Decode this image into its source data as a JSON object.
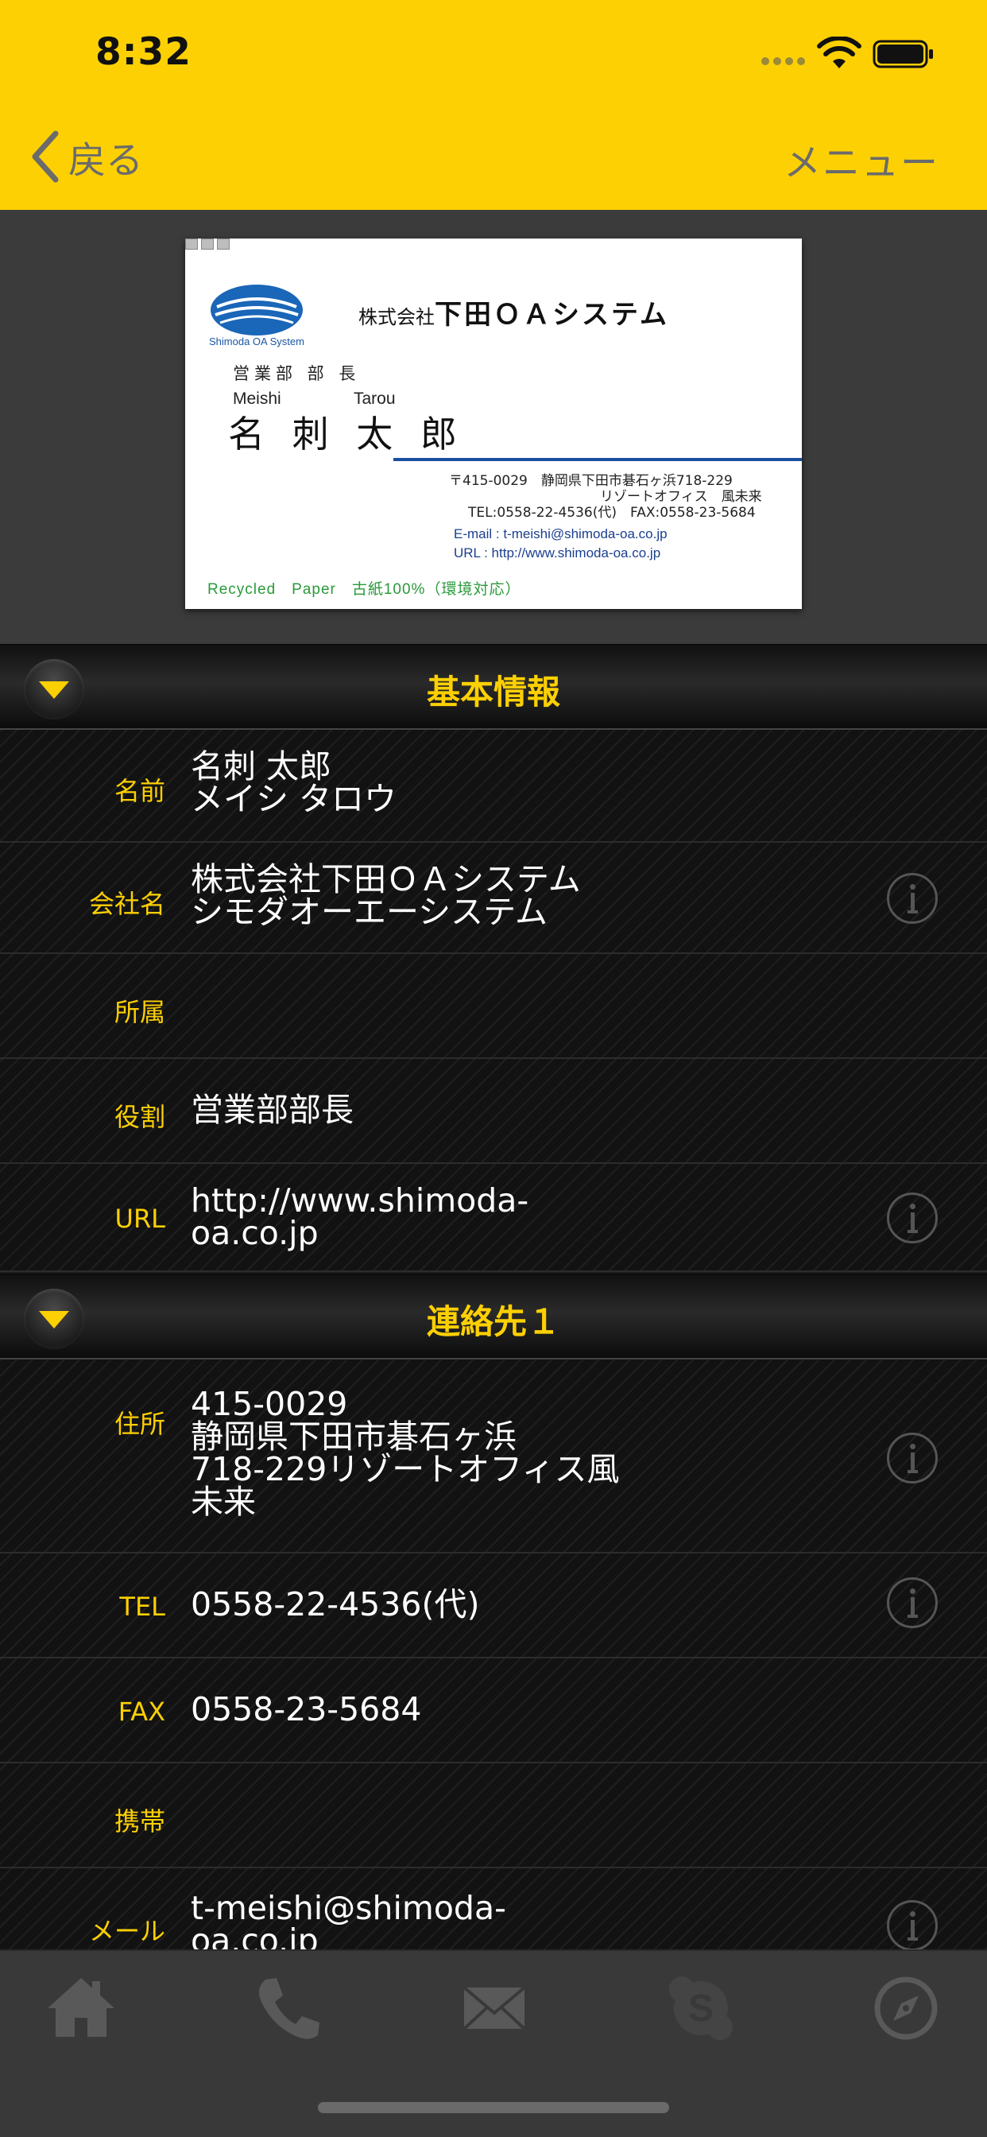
{
  "status_bar": {
    "time": "8:32"
  },
  "nav": {
    "back_label": "戻る",
    "menu_label": "メニュー"
  },
  "card_image": {
    "company_prefix": "株式会社",
    "company_name": "下田ＯＡシステム",
    "logo_text": "Shimoda OA System",
    "department": "営業部 部 長",
    "roman_family": "Meishi",
    "roman_given": "Tarou",
    "name": "名 刺  太 郎",
    "address_line1": "〒415-0029　静岡県下田市碁石ヶ浜718-229",
    "address_line2": "リゾートオフィス　風未来",
    "address_line3": "TEL:0558-22-4536(代)　FAX:0558-23-5684",
    "email": "E-mail : t-meishi@shimoda-oa.co.jp",
    "url": "URL : http://www.shimoda-oa.co.jp",
    "recycled": "Recycled　Paper　古紙100%（環境対応）"
  },
  "sections": [
    {
      "title": "基本情報",
      "rows": [
        {
          "label": "名前",
          "lines": [
            "名刺 太郎",
            "メイシ タロウ"
          ]
        },
        {
          "label": "会社名",
          "lines": [
            "株式会社下田ＯＡシステム",
            "シモダオーエーシステム"
          ]
        },
        {
          "label": "所属",
          "lines": []
        },
        {
          "label": "役割",
          "lines": [
            "営業部部長"
          ]
        },
        {
          "label": "URL",
          "lines": [
            "http://www.shimoda-",
            "oa.co.jp"
          ]
        }
      ]
    },
    {
      "title": "連絡先１",
      "rows": [
        {
          "label": "住所",
          "lines": [
            "415-0029",
            "静岡県下田市碁石ヶ浜",
            "718-229リゾートオフィス風",
            "未来"
          ]
        },
        {
          "label": "TEL",
          "lines": [
            "0558-22-4536(代)"
          ]
        },
        {
          "label": "FAX",
          "lines": [
            "0558-23-5684"
          ]
        },
        {
          "label": "携帯",
          "lines": []
        },
        {
          "label": "メール",
          "lines": [
            "t-meishi@shimoda-",
            "oa.co.jp"
          ]
        }
      ]
    }
  ],
  "tabbar": {
    "icons": [
      "home-icon",
      "phone-icon",
      "mail-icon",
      "skype-icon",
      "compass-icon"
    ]
  },
  "colors": {
    "accent": "#fdd003",
    "background": "#121212",
    "tabbar": "#393939"
  }
}
